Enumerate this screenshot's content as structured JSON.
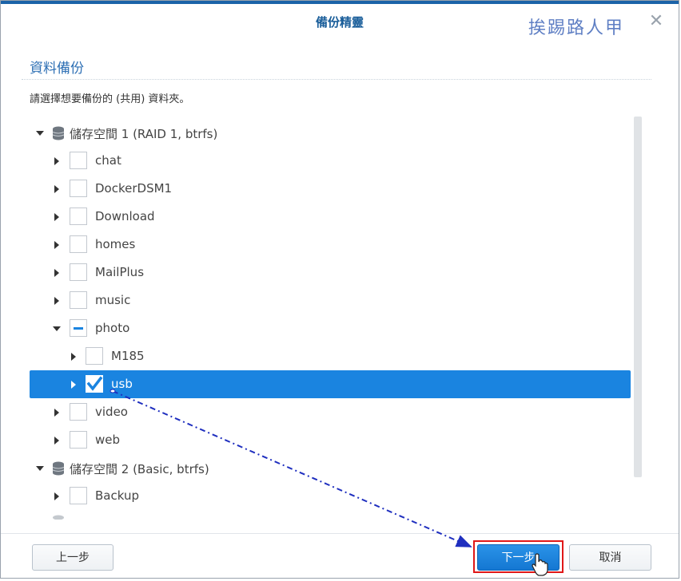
{
  "window": {
    "title": "備份精靈",
    "watermark": "挨踢路人甲",
    "close_glyph": "✕"
  },
  "section_title": "資料備份",
  "description": "請選擇想要備份的 (共用) 資料夾。",
  "tree": {
    "volume1": {
      "label": "儲存空間 1 (RAID 1, btrfs)"
    },
    "volume1_items": [
      {
        "label": "chat",
        "state": "unchecked"
      },
      {
        "label": "DockerDSM1",
        "state": "unchecked"
      },
      {
        "label": "Download",
        "state": "unchecked"
      },
      {
        "label": "homes",
        "state": "unchecked"
      },
      {
        "label": "MailPlus",
        "state": "unchecked"
      },
      {
        "label": "music",
        "state": "unchecked"
      }
    ],
    "photo": {
      "label": "photo",
      "state": "partial"
    },
    "photo_children": [
      {
        "label": "M185",
        "state": "unchecked"
      },
      {
        "label": "usb",
        "state": "checked",
        "selected": true
      }
    ],
    "after_photo": [
      {
        "label": "video",
        "state": "unchecked"
      },
      {
        "label": "web",
        "state": "unchecked"
      }
    ],
    "volume2": {
      "label": "儲存空間 2 (Basic, btrfs)"
    },
    "volume2_items": [
      {
        "label": "Backup",
        "state": "unchecked"
      }
    ]
  },
  "footer": {
    "back_label": "上一步",
    "next_label": "下一步",
    "cancel_label": "取消"
  },
  "colors": {
    "accent": "#1a84e0",
    "title": "#1a5e9a",
    "highlight_box": "#e01818",
    "annotation_arrow": "#1f2fbf"
  }
}
